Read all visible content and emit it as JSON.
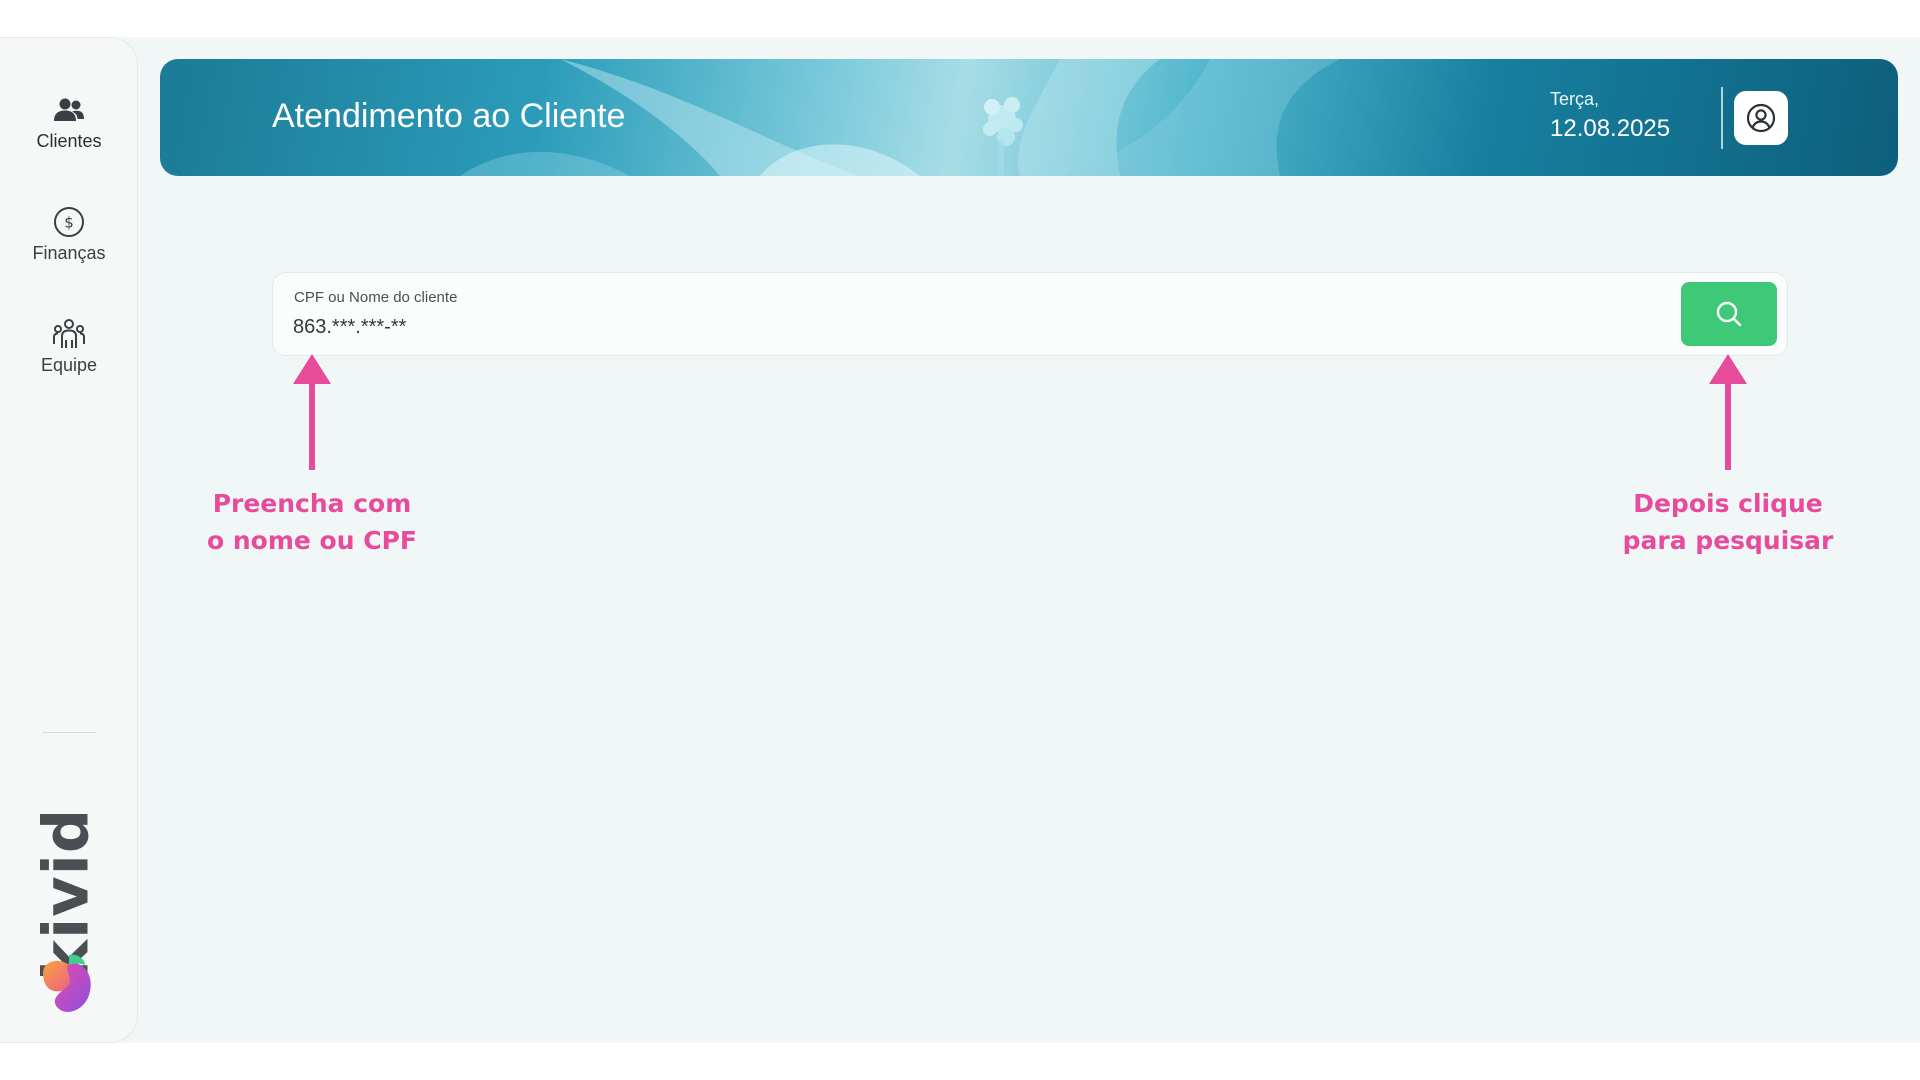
{
  "sidebar": {
    "items": [
      {
        "label": "Clientes",
        "icon": "users-icon",
        "active": true
      },
      {
        "label": "Finanças",
        "icon": "dollar-circle-icon",
        "active": false
      },
      {
        "label": "Equipe",
        "icon": "team-icon",
        "active": false
      }
    ],
    "brand": {
      "name": "kivid",
      "logo": "kivid-logo-icon"
    }
  },
  "header": {
    "title": "Atendimento ao Cliente",
    "day": "Terça,",
    "date": "12.08.2025",
    "user_icon": "user-circle-icon"
  },
  "search": {
    "label": "CPF ou Nome do cliente",
    "value": "863.***.***-**",
    "button_icon": "search-icon",
    "button_color": "#3fc878"
  },
  "annotations": {
    "left_line1": "Preencha com",
    "left_line2": "o nome ou CPF",
    "right_line1": "Depois clique",
    "right_line2": "para pesquisar",
    "color": "#e84b9b"
  }
}
